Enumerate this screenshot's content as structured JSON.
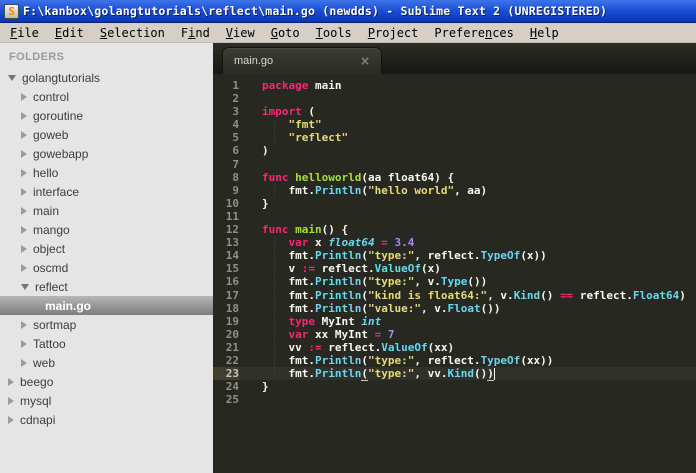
{
  "window": {
    "title": "F:\\kanbox\\golangtutorials\\reflect\\main.go (newdds) - Sublime Text 2 (UNREGISTERED)",
    "app_icon_letter": "S"
  },
  "menu": {
    "items": [
      {
        "label": "File",
        "underline_index": 0
      },
      {
        "label": "Edit",
        "underline_index": 0
      },
      {
        "label": "Selection",
        "underline_index": 0
      },
      {
        "label": "Find",
        "underline_index": 1
      },
      {
        "label": "View",
        "underline_index": 0
      },
      {
        "label": "Goto",
        "underline_index": 0
      },
      {
        "label": "Tools",
        "underline_index": 0
      },
      {
        "label": "Project",
        "underline_index": 0
      },
      {
        "label": "Preferences",
        "underline_index": 7
      },
      {
        "label": "Help",
        "underline_index": 0
      }
    ]
  },
  "sidebar": {
    "header": "FOLDERS",
    "items": [
      {
        "label": "golangtutorials",
        "depth": 0,
        "state": "expanded",
        "selected": false
      },
      {
        "label": "control",
        "depth": 1,
        "state": "collapsed",
        "selected": false
      },
      {
        "label": "goroutine",
        "depth": 1,
        "state": "collapsed",
        "selected": false
      },
      {
        "label": "goweb",
        "depth": 1,
        "state": "collapsed",
        "selected": false
      },
      {
        "label": "gowebapp",
        "depth": 1,
        "state": "collapsed",
        "selected": false
      },
      {
        "label": "hello",
        "depth": 1,
        "state": "collapsed",
        "selected": false
      },
      {
        "label": "interface",
        "depth": 1,
        "state": "collapsed",
        "selected": false
      },
      {
        "label": "main",
        "depth": 1,
        "state": "collapsed",
        "selected": false
      },
      {
        "label": "mango",
        "depth": 1,
        "state": "collapsed",
        "selected": false
      },
      {
        "label": "object",
        "depth": 1,
        "state": "collapsed",
        "selected": false
      },
      {
        "label": "oscmd",
        "depth": 1,
        "state": "collapsed",
        "selected": false
      },
      {
        "label": "reflect",
        "depth": 1,
        "state": "expanded",
        "selected": false
      },
      {
        "label": "main.go",
        "depth": 2,
        "state": "file",
        "selected": true
      },
      {
        "label": "sortmap",
        "depth": 1,
        "state": "collapsed",
        "selected": false
      },
      {
        "label": "Tattoo",
        "depth": 1,
        "state": "collapsed",
        "selected": false
      },
      {
        "label": "web",
        "depth": 1,
        "state": "collapsed",
        "selected": false
      },
      {
        "label": "beego",
        "depth": 0,
        "state": "collapsed",
        "selected": false
      },
      {
        "label": "mysql",
        "depth": 0,
        "state": "collapsed",
        "selected": false
      },
      {
        "label": "cdnapi",
        "depth": 0,
        "state": "collapsed",
        "selected": false
      }
    ]
  },
  "tabs": [
    {
      "label": "main.go",
      "close_glyph": "×",
      "active": true
    }
  ],
  "editor": {
    "language": "Go",
    "lines": [
      {
        "n": 1,
        "indent": false,
        "current": false,
        "caret": false,
        "tokens": [
          [
            "k",
            "package"
          ],
          [
            "p",
            " main"
          ]
        ]
      },
      {
        "n": 2,
        "indent": false,
        "current": false,
        "caret": false,
        "tokens": []
      },
      {
        "n": 3,
        "indent": false,
        "current": false,
        "caret": false,
        "tokens": [
          [
            "k",
            "import"
          ],
          [
            "p",
            " ("
          ]
        ]
      },
      {
        "n": 4,
        "indent": true,
        "current": false,
        "caret": false,
        "tokens": [
          [
            "p",
            "    "
          ],
          [
            "s",
            "\"fmt\""
          ]
        ]
      },
      {
        "n": 5,
        "indent": true,
        "current": false,
        "caret": false,
        "tokens": [
          [
            "p",
            "    "
          ],
          [
            "s",
            "\"reflect\""
          ]
        ]
      },
      {
        "n": 6,
        "indent": false,
        "current": false,
        "caret": false,
        "tokens": [
          [
            "p",
            ")"
          ]
        ]
      },
      {
        "n": 7,
        "indent": false,
        "current": false,
        "caret": false,
        "tokens": []
      },
      {
        "n": 8,
        "indent": false,
        "current": false,
        "caret": false,
        "tokens": [
          [
            "k",
            "func"
          ],
          [
            "p",
            " "
          ],
          [
            "f",
            "helloworld"
          ],
          [
            "p",
            "(aa float64) {"
          ]
        ]
      },
      {
        "n": 9,
        "indent": true,
        "current": false,
        "caret": false,
        "tokens": [
          [
            "p",
            "    fmt."
          ],
          [
            "c",
            "Println"
          ],
          [
            "p",
            "("
          ],
          [
            "s",
            "\"hello world\""
          ],
          [
            "p",
            ", aa)"
          ]
        ]
      },
      {
        "n": 10,
        "indent": false,
        "current": false,
        "caret": false,
        "tokens": [
          [
            "p",
            "}"
          ]
        ]
      },
      {
        "n": 11,
        "indent": false,
        "current": false,
        "caret": false,
        "tokens": []
      },
      {
        "n": 12,
        "indent": false,
        "current": false,
        "caret": false,
        "tokens": [
          [
            "k",
            "func"
          ],
          [
            "p",
            " "
          ],
          [
            "f",
            "main"
          ],
          [
            "p",
            "() {"
          ]
        ]
      },
      {
        "n": 13,
        "indent": true,
        "current": false,
        "caret": false,
        "tokens": [
          [
            "p",
            "    "
          ],
          [
            "k",
            "var"
          ],
          [
            "p",
            " x "
          ],
          [
            "t",
            "float64"
          ],
          [
            "p",
            " "
          ],
          [
            "o",
            "="
          ],
          [
            "p",
            " "
          ],
          [
            "n",
            "3.4"
          ]
        ]
      },
      {
        "n": 14,
        "indent": true,
        "current": false,
        "caret": false,
        "tokens": [
          [
            "p",
            "    fmt."
          ],
          [
            "c",
            "Println"
          ],
          [
            "p",
            "("
          ],
          [
            "s",
            "\"type:\""
          ],
          [
            "p",
            ", reflect."
          ],
          [
            "c",
            "TypeOf"
          ],
          [
            "p",
            "(x))"
          ]
        ]
      },
      {
        "n": 15,
        "indent": true,
        "current": false,
        "caret": false,
        "tokens": [
          [
            "p",
            "    v "
          ],
          [
            "o",
            ":="
          ],
          [
            "p",
            " reflect."
          ],
          [
            "c",
            "ValueOf"
          ],
          [
            "p",
            "(x)"
          ]
        ]
      },
      {
        "n": 16,
        "indent": true,
        "current": false,
        "caret": false,
        "tokens": [
          [
            "p",
            "    fmt."
          ],
          [
            "c",
            "Println"
          ],
          [
            "p",
            "("
          ],
          [
            "s",
            "\"type:\""
          ],
          [
            "p",
            ", v."
          ],
          [
            "c",
            "Type"
          ],
          [
            "p",
            "())"
          ]
        ]
      },
      {
        "n": 17,
        "indent": true,
        "current": false,
        "caret": false,
        "tokens": [
          [
            "p",
            "    fmt."
          ],
          [
            "c",
            "Println"
          ],
          [
            "p",
            "("
          ],
          [
            "s",
            "\"kind is float64:\""
          ],
          [
            "p",
            ", v."
          ],
          [
            "c",
            "Kind"
          ],
          [
            "p",
            "() "
          ],
          [
            "o",
            "=="
          ],
          [
            "p",
            " reflect."
          ],
          [
            "c",
            "Float64"
          ],
          [
            "p",
            ")"
          ]
        ]
      },
      {
        "n": 18,
        "indent": true,
        "current": false,
        "caret": false,
        "tokens": [
          [
            "p",
            "    fmt."
          ],
          [
            "c",
            "Println"
          ],
          [
            "p",
            "("
          ],
          [
            "s",
            "\"value:\""
          ],
          [
            "p",
            ", v."
          ],
          [
            "c",
            "Float"
          ],
          [
            "p",
            "())"
          ]
        ]
      },
      {
        "n": 19,
        "indent": true,
        "current": false,
        "caret": false,
        "tokens": [
          [
            "p",
            "    "
          ],
          [
            "k",
            "type"
          ],
          [
            "p",
            " MyInt "
          ],
          [
            "t",
            "int"
          ]
        ]
      },
      {
        "n": 20,
        "indent": true,
        "current": false,
        "caret": false,
        "tokens": [
          [
            "p",
            "    "
          ],
          [
            "k",
            "var"
          ],
          [
            "p",
            " xx MyInt "
          ],
          [
            "o",
            "="
          ],
          [
            "p",
            " "
          ],
          [
            "n",
            "7"
          ]
        ]
      },
      {
        "n": 21,
        "indent": true,
        "current": false,
        "caret": false,
        "tokens": [
          [
            "p",
            "    vv "
          ],
          [
            "o",
            ":="
          ],
          [
            "p",
            " reflect."
          ],
          [
            "c",
            "ValueOf"
          ],
          [
            "p",
            "(xx)"
          ]
        ]
      },
      {
        "n": 22,
        "indent": true,
        "current": false,
        "caret": false,
        "tokens": [
          [
            "p",
            "    fmt."
          ],
          [
            "c",
            "Println"
          ],
          [
            "p",
            "("
          ],
          [
            "s",
            "\"type:\""
          ],
          [
            "p",
            ", reflect."
          ],
          [
            "c",
            "TypeOf"
          ],
          [
            "p",
            "(xx))"
          ]
        ]
      },
      {
        "n": 23,
        "indent": true,
        "current": true,
        "caret": true,
        "tokens": [
          [
            "p",
            "    fmt."
          ],
          [
            "c",
            "Println"
          ],
          [
            "u",
            "("
          ],
          [
            "s",
            "\"type:\""
          ],
          [
            "p",
            ", vv."
          ],
          [
            "c",
            "Kind"
          ],
          [
            "p",
            "()"
          ],
          [
            "u",
            ")"
          ]
        ]
      },
      {
        "n": 24,
        "indent": false,
        "current": false,
        "caret": false,
        "tokens": [
          [
            "p",
            "}"
          ]
        ]
      },
      {
        "n": 25,
        "indent": false,
        "current": false,
        "caret": false,
        "tokens": []
      }
    ]
  },
  "colors": {
    "titlebar_blue": "#1c50d8",
    "menubar_gray": "#d4d0c8",
    "sidebar_bg": "#e5e5e5",
    "sidebar_selected_top": "#b6b6b6",
    "sidebar_selected_bottom": "#7c7c7c",
    "editor_bg": "#272822",
    "gutter_text": "#8f908a",
    "keyword": "#f92672",
    "func_name": "#a6e22e",
    "call": "#66d9ef",
    "string": "#e6db74",
    "number": "#ae81ff",
    "plain": "#f8f8f2"
  }
}
